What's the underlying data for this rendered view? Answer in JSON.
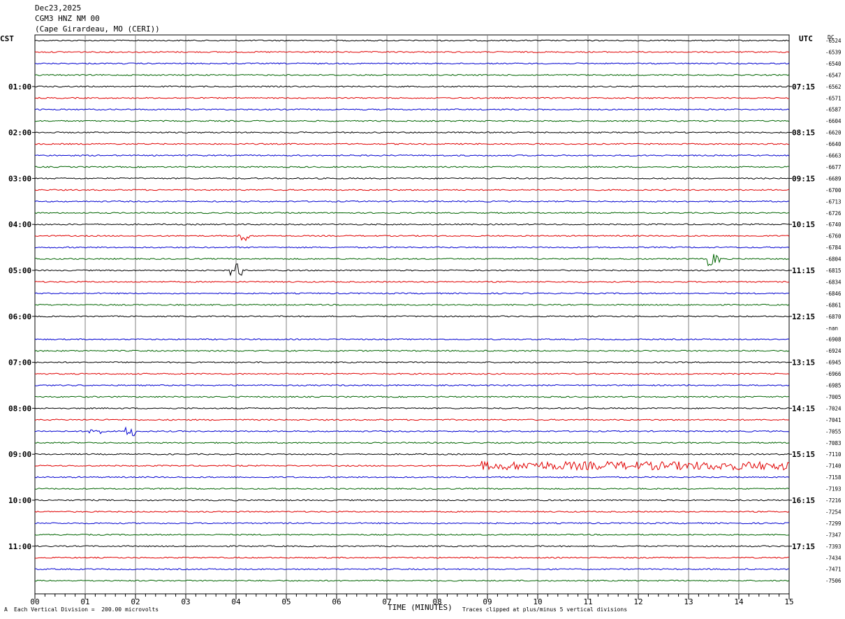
{
  "header": {
    "date": "Dec23,2025",
    "station": "CGM3 HNZ NM 00",
    "location": "(Cape Girardeau, MO (CERI))"
  },
  "left_label": "CST",
  "right_label": "UTC",
  "dc_label": "DC",
  "footer": {
    "scale_note": "Each Vertical Division =  200.00 microvolts",
    "x_axis_title": "TIME (MINUTES)",
    "clip_note": "Traces clipped at plus/minus 5 vertical divisions",
    "corner_mark": "A"
  },
  "chart_data": {
    "type": "line",
    "title": "CGM3 HNZ NM 00",
    "xlabel": "TIME (MINUTES)",
    "x_range": [
      0,
      15
    ],
    "x_ticks": [
      "00",
      "01",
      "02",
      "03",
      "04",
      "05",
      "06",
      "07",
      "08",
      "09",
      "10",
      "11",
      "12",
      "13",
      "14",
      "15"
    ],
    "trace_colors": [
      "#000000",
      "#e00000",
      "#0000d0",
      "#006400"
    ],
    "left_hour_labels": [
      "01:00",
      "02:00",
      "03:00",
      "04:00",
      "05:00",
      "06:00",
      "07:00",
      "08:00",
      "09:00",
      "10:00",
      "11:00"
    ],
    "right_hour_labels": [
      "07:15",
      "08:15",
      "09:15",
      "10:15",
      "11:15",
      "12:15",
      "13:15",
      "14:15",
      "15:15",
      "16:15",
      "17:15"
    ],
    "dc_offsets": [
      "-6524",
      "-6539",
      "-6540",
      "-6547",
      "-6562",
      "-6571",
      "-6587",
      "-6604",
      "-6620",
      "-6640",
      "-6663",
      "-6677",
      "-6689",
      "-6700",
      "-6713",
      "-6726",
      "-6740",
      "-6760",
      "-6784",
      "-6804",
      "-6815",
      "-6834",
      "-6846",
      "-6861",
      "-6870",
      "-nan",
      "-6908",
      "-6924",
      "-6945",
      "-6966",
      "-6985",
      "-7005",
      "-7024",
      "-7041",
      "-7055",
      "-7083",
      "-7110",
      "-7140",
      "-7158",
      "-7193",
      "-7216",
      "-7254",
      "-7299",
      "-7347",
      "-7393",
      "-7434",
      "-7471",
      "-7506"
    ],
    "events": [
      {
        "trace": 17,
        "minute": 4.15,
        "note": "burst"
      },
      {
        "trace": 19,
        "minute": 13.5,
        "note": "spike"
      },
      {
        "trace": 20,
        "minute": 4.0,
        "note": "event"
      },
      {
        "trace": 34,
        "minute": 1.2,
        "note": "burst"
      },
      {
        "trace": 34,
        "minute": 1.9,
        "note": "burst"
      },
      {
        "trace": 37,
        "minute": 9.0,
        "note": "high noise until end"
      }
    ]
  }
}
